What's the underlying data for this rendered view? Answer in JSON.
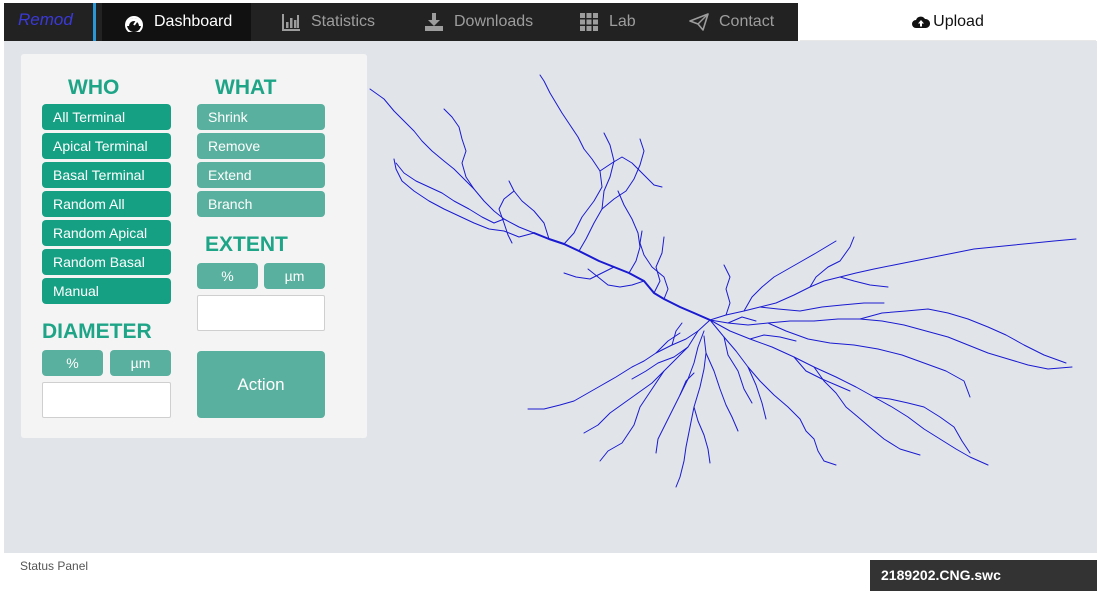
{
  "nav": {
    "brand": "Remod",
    "items": [
      {
        "label": "Dashboard",
        "icon": "dashboard-icon",
        "active": true
      },
      {
        "label": "Statistics",
        "icon": "bar-chart-icon"
      },
      {
        "label": "Downloads",
        "icon": "download-icon"
      },
      {
        "label": "Lab",
        "icon": "grid-icon"
      },
      {
        "label": "Contact",
        "icon": "paper-plane-icon"
      }
    ],
    "upload": {
      "label": "Upload",
      "icon": "cloud-upload-icon"
    }
  },
  "colors": {
    "navbar": "#222222",
    "accent_dark": "#16a083",
    "accent_light": "#5ab09e",
    "section_title": "#1ea587",
    "workspace": "#e1e5e9",
    "neuron": "#1a1ad0"
  },
  "who": {
    "title": "WHO",
    "buttons": [
      "All Terminal",
      "Apical Terminal",
      "Basal Terminal",
      "Random All",
      "Random Apical",
      "Random Basal",
      "Manual"
    ]
  },
  "what": {
    "title": "WHAT",
    "buttons": [
      "Shrink",
      "Remove",
      "Extend",
      "Branch"
    ]
  },
  "extent": {
    "title": "EXTENT",
    "unit_percent": "%",
    "unit_micron": "µm",
    "value": ""
  },
  "diameter": {
    "title": "DIAMETER",
    "unit_percent": "%",
    "unit_micron": "µm",
    "value": ""
  },
  "action": {
    "label": "Action"
  },
  "status": {
    "label": "Status Panel",
    "file": "2189202.CNG.swc"
  }
}
